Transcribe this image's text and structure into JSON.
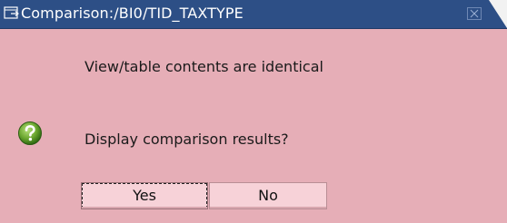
{
  "dialog": {
    "title": "Comparison:/BI0/TID_TAXTYPE",
    "title_icon": "window-icon",
    "close_icon": "close-icon",
    "message": "View/table contents are identical",
    "question": "Display comparison results?",
    "question_icon": "question-icon",
    "buttons": {
      "yes": "Yes",
      "no": "No"
    }
  },
  "colors": {
    "titlebar": "#2d4f86",
    "background": "#e6aeb7",
    "button": "#f7d2d8",
    "question_icon": "#6aa62f"
  }
}
